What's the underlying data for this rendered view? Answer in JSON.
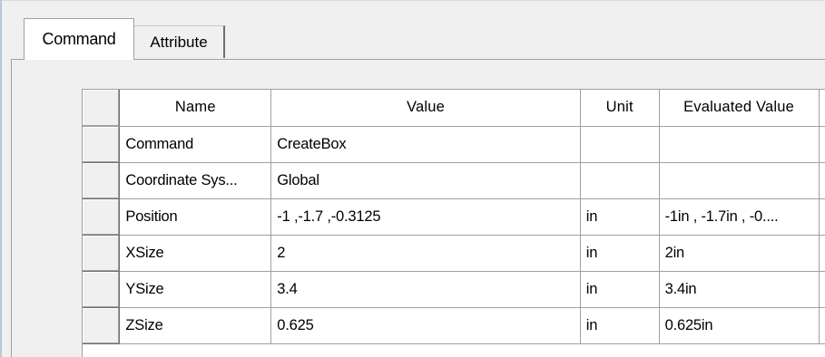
{
  "tabs": [
    {
      "label": "Command",
      "active": true
    },
    {
      "label": "Attribute",
      "active": false
    }
  ],
  "grid": {
    "columns": [
      "Name",
      "Value",
      "Unit",
      "Evaluated Value"
    ],
    "rows": [
      {
        "name": "Command",
        "value": "CreateBox",
        "unit": "",
        "evaluated": ""
      },
      {
        "name": "Coordinate Sys...",
        "value": "Global",
        "unit": "",
        "evaluated": ""
      },
      {
        "name": "Position",
        "value": "-1 ,-1.7 ,-0.3125",
        "unit": "in",
        "evaluated": "-1in , -1.7in , -0...."
      },
      {
        "name": "XSize",
        "value": "2",
        "unit": "in",
        "evaluated": "2in"
      },
      {
        "name": "YSize",
        "value": "3.4",
        "unit": "in",
        "evaluated": "3.4in"
      },
      {
        "name": "ZSize",
        "value": "0.625",
        "unit": "in",
        "evaluated": "0.625in"
      }
    ]
  }
}
